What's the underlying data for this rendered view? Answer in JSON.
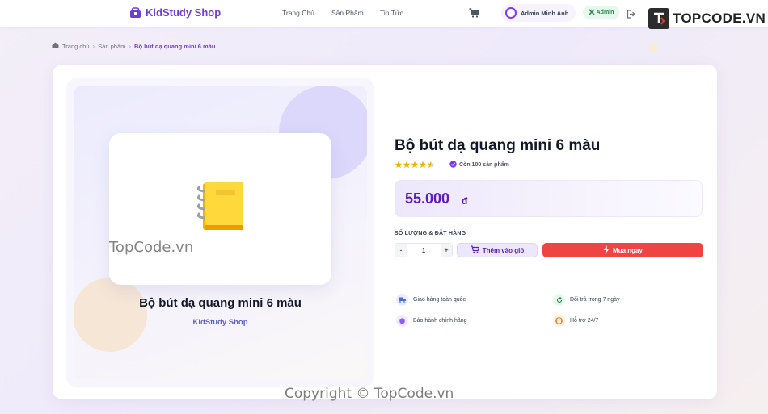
{
  "header": {
    "brand": "KidStudy Shop",
    "nav": [
      "Trang Chủ",
      "Sản Phẩm",
      "Tin Tức"
    ],
    "user_name": "Admin Minh Anh",
    "role_badge": "Admin"
  },
  "breadcrumb": {
    "home": "Trang chủ",
    "products": "Sản phẩm",
    "current": "Bộ bút dạ quang mini 6 màu"
  },
  "product": {
    "image_name": "Bộ bút dạ quang mini 6 màu",
    "brand": "KidStudy Shop",
    "title": "Bộ bút dạ quang mini 6 màu",
    "rating": 4.5,
    "stock": "Còn 100 sản phẩm",
    "price": "55.000",
    "currency": "đ"
  },
  "order": {
    "label": "SỐ LƯỢNG & ĐẶT HÀNG",
    "minus": "-",
    "quantity": "1",
    "plus": "+",
    "add_to_cart": "Thêm vào giỏ",
    "buy_now": "Mua ngay"
  },
  "features": [
    {
      "icon": "truck-icon",
      "label": "Giao hàng toàn quốc"
    },
    {
      "icon": "return-icon",
      "label": "Đổi trả trong 7 ngày"
    },
    {
      "icon": "shield-icon",
      "label": "Bảo hành chính hãng"
    },
    {
      "icon": "support-icon",
      "label": "Hỗ trợ 24/7"
    }
  ],
  "watermark": {
    "logo": "TOPCODE.VN",
    "mid": "TopCode.vn",
    "bottom": "Copyright © TopCode.vn"
  },
  "colors": {
    "accent": "#6d3fd4",
    "price": "#5b21b6",
    "buy": "#ef4444"
  }
}
